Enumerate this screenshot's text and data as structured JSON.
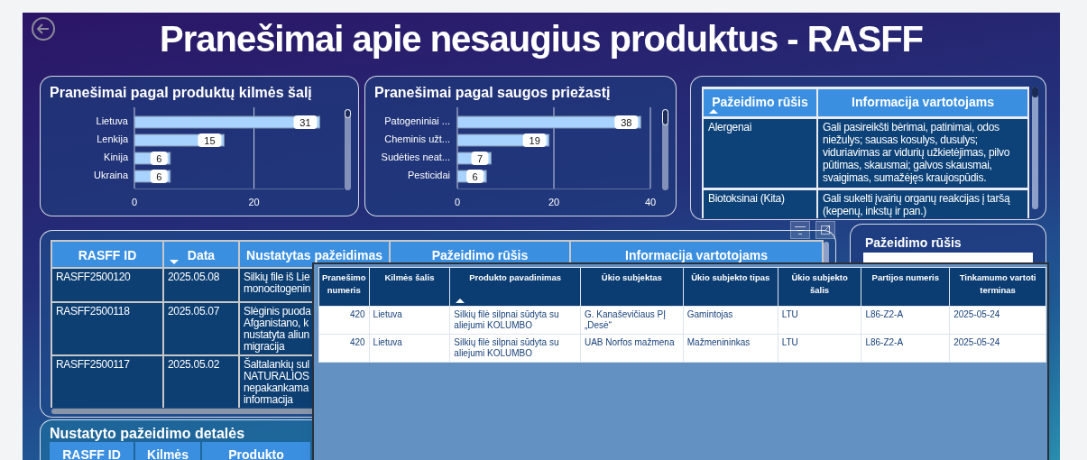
{
  "title": "Pranešimai apie nesaugius produktus - RASFF",
  "charts": [
    {
      "chart_data": {
        "type": "bar",
        "orientation": "horizontal",
        "title": "Pranešimai pagal produktų kilmės šalį",
        "categories": [
          "Lietuva",
          "Lenkija",
          "Kinija",
          "Ukraina"
        ],
        "values": [
          31,
          15,
          6,
          6
        ],
        "xlim": [
          0,
          35
        ],
        "xticks": [
          0,
          20
        ],
        "data_labels": true
      }
    },
    {
      "chart_data": {
        "type": "bar",
        "orientation": "horizontal",
        "title": "Pranešimai pagal saugos priežastį",
        "categories": [
          "Patogeniniai ...",
          "Cheminis užt...",
          "Sudėties neat...",
          "Pesticidai"
        ],
        "values": [
          38,
          19,
          7,
          6
        ],
        "xlim": [
          0,
          40
        ],
        "xticks": [
          0,
          20,
          40
        ],
        "data_labels": true
      }
    }
  ],
  "info_table": {
    "sort_descending": false,
    "columns": [
      {
        "label": "Pažeidimo rūšis",
        "sorted": true
      },
      {
        "label": "Informacija vartotojams",
        "sorted": false
      }
    ],
    "rows": [
      {
        "cells": [
          "Alergenai",
          "Gali pasireikšti bėrimai, patinimai, odos niežulys; sausas kosulys, dusulys; viduriavimas ar vidurių užkietėjimas, pilvo pūtimas, skausmai; galvos skausmai, svaigimas, sumažėjęs kraujospūdis."
        ]
      },
      {
        "cells": [
          "Biotoksinai (Kita)",
          "Gali sukelti įvairių organų reakcijas į taršą (kepenų, inkstų ir pan.)"
        ]
      }
    ]
  },
  "main_table": {
    "sort_descending": true,
    "columns": [
      {
        "label": "RASFF ID",
        "sorted": false
      },
      {
        "label": "Data",
        "sorted": true
      },
      {
        "label": "Nustatytas pažeidimas",
        "sorted": false
      },
      {
        "label": "Pažeidimo rūšis",
        "sorted": false
      },
      {
        "label": "Informacija vartotojams",
        "sorted": false
      }
    ],
    "rows": [
      {
        "cells": [
          "RASFF2500120",
          "2025.05.08",
          "Silkių file iš Lie\nmonocitogenin"
        ]
      },
      {
        "cells": [
          "RASFF2500118",
          "2025.05.07",
          "Slėginis puoda\nAfganistano, k\nnustatyta aliun\nmigracija"
        ]
      },
      {
        "cells": [
          "RASFF2500117",
          "2025.05.02",
          "Šaltalankių sul\nNATURALIOS\nnepakankama\ninformacija"
        ]
      }
    ]
  },
  "slicer": {
    "title": "Pažeidimo rūšis"
  },
  "details": {
    "title": "Nustatyto pažeidimo detalės",
    "columns": [
      "RASFF ID",
      "Kilmės",
      "Produkto"
    ]
  },
  "popup_table": {
    "sort_descending": false,
    "columns": [
      {
        "label": "Pranešimo numeris",
        "sorted": false
      },
      {
        "label": "Kilmės šalis",
        "sorted": false
      },
      {
        "label": "Produkto pavadinimas",
        "sorted": true
      },
      {
        "label": "Ūkio subjektas",
        "sorted": false
      },
      {
        "label": "Ūkio subjekto tipas",
        "sorted": false
      },
      {
        "label": "Ūkio subjekto šalis",
        "sorted": false
      },
      {
        "label": "Partijos numeris",
        "sorted": false
      },
      {
        "label": "Tinkamumo vartoti terminas",
        "sorted": false
      }
    ],
    "rows": [
      {
        "cells": [
          "420",
          "Lietuva",
          "Silkių filė silpnai sūdyta su aliejumi KOLUMBO",
          "G. Kanaševičiaus PĮ „Desė“",
          "Gamintojas",
          "LTU",
          "L86-Z2-A",
          "2025-05-24"
        ]
      },
      {
        "cells": [
          "420",
          "Lietuva",
          "Silkių filė silpnai sūdyta su aliejumi KOLUMBO",
          "UAB Norfos mažmena",
          "Mažmenininkas",
          "LTU",
          "L86-Z2-A",
          "2025-05-24"
        ]
      }
    ]
  }
}
